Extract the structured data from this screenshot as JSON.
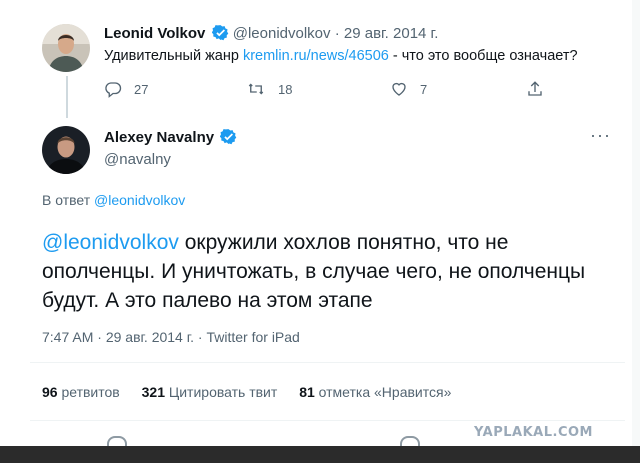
{
  "reply_tweet": {
    "author_name": "Leonid Volkov",
    "author_handle": "@leonidvolkov",
    "separator": "·",
    "date": "29 авг. 2014 г.",
    "text_before": "Удивительный жанр ",
    "link": "kremlin.ru/news/46506",
    "text_after": " - что это вообще означает?",
    "reply_count": "27",
    "retweet_count": "18",
    "like_count": "7"
  },
  "main_tweet": {
    "author_name": "Alexey Navalny",
    "author_handle": "@navalny",
    "more_label": "···",
    "replying_prefix": "В ответ ",
    "replying_handle": "@leonidvolkov",
    "mention": "@leonidvolkov",
    "text": " окружили хохлов понятно, что не ополченцы. И уничтожать, в случае чего, не ополченцы будут. А это палево на этом этапе",
    "time": "7:47 AM",
    "date": "29 авг. 2014 г.",
    "source": "Twitter for iPad",
    "meta_sep": " · ",
    "stats": {
      "retweets_count": "96",
      "retweets_label": "ретвитов",
      "quotes_count": "321",
      "quotes_label": "Цитировать твит",
      "likes_count": "81",
      "likes_label": "отметка «Нравится»"
    }
  },
  "watermark": "YAPLAKAL.COM",
  "colors": {
    "accent": "#1d9bf0",
    "muted": "#536471",
    "text": "#0f1419",
    "divider": "#eff3f4"
  }
}
